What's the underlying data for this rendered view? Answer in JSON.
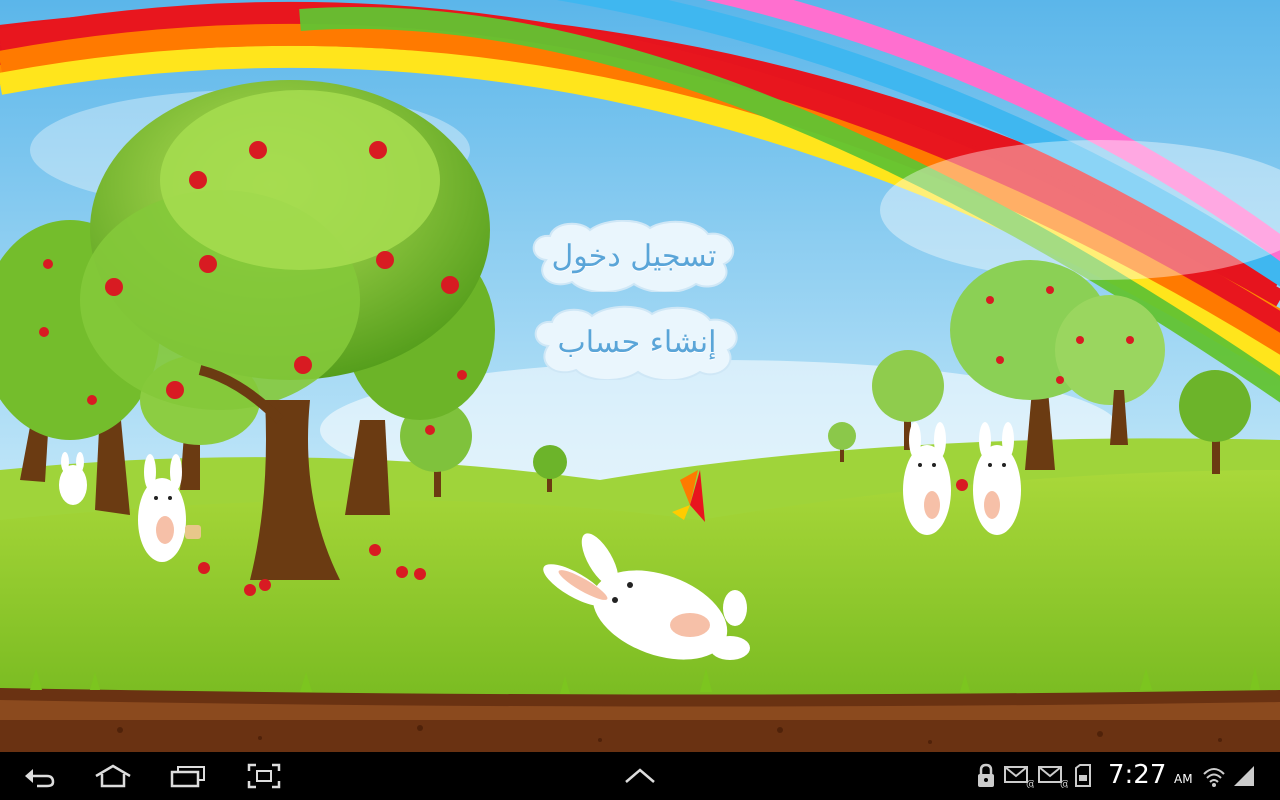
{
  "game": {
    "login_label": "تسجيل دخول",
    "signup_label": "إنشاء حساب"
  },
  "status_bar": {
    "time": "7:27",
    "ampm": "AM",
    "icons": [
      "lock-icon",
      "email-icon",
      "email-icon",
      "sd-card-icon",
      "wifi-icon",
      "signal-icon"
    ]
  },
  "nav_bar": {
    "buttons": [
      "back-icon",
      "home-icon",
      "recent-apps-icon",
      "screenshot-icon",
      "menu-up-icon"
    ]
  },
  "colors": {
    "sky": "#7cc6ee",
    "grass": "#8dcc2a",
    "soil": "#5a2a10",
    "button_text": "#5aa5d8"
  }
}
